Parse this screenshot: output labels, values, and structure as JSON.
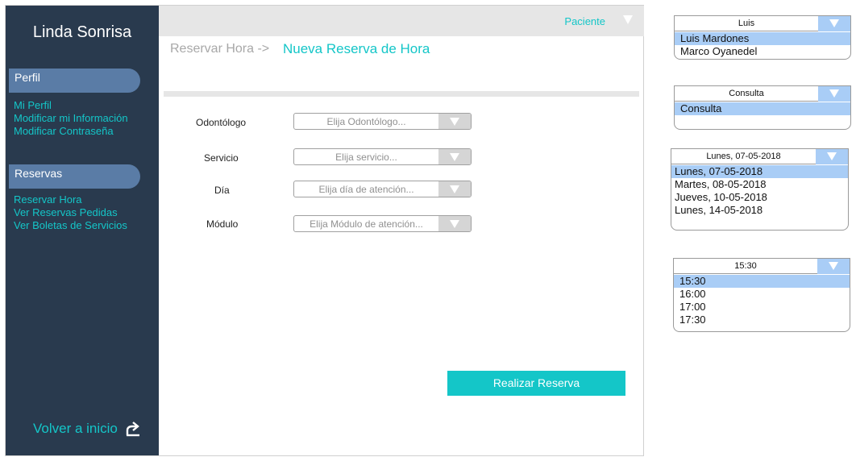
{
  "sidebar": {
    "brand": "Linda Sonrisa",
    "perfil": {
      "title": "Perfil",
      "links": [
        "Mi Perfil",
        "Modificar mi Información",
        "Modificar Contraseña"
      ]
    },
    "reservas": {
      "title": "Reservas",
      "links": [
        "Reservar Hora",
        "Ver Reservas Pedidas",
        "Ver Boletas de Servicios"
      ]
    },
    "back_label": "Volver a inicio",
    "back_icon": "return-arrow-icon"
  },
  "header": {
    "user_label": "Paciente",
    "user_icon": "caret-down-icon"
  },
  "breadcrumb": {
    "parent": "Reservar Hora ->",
    "current": "Nueva Reserva de Hora"
  },
  "form": {
    "fields": [
      {
        "label": "Odontólogo",
        "placeholder": "Elija Odontólogo..."
      },
      {
        "label": "Servicio",
        "placeholder": "Elija servicio..."
      },
      {
        "label": "Día",
        "placeholder": "Elija día de atención..."
      },
      {
        "label": "Módulo",
        "placeholder": "Elija Módulo de atención..."
      }
    ],
    "submit_label": "Realizar Reserva"
  },
  "dropdown_examples": {
    "odontologo": {
      "selected": "Luis",
      "options": [
        "Luis Mardones",
        "Marco Oyanedel"
      ]
    },
    "servicio": {
      "selected": "Consulta",
      "options": [
        "Consulta"
      ]
    },
    "dia": {
      "selected": "Lunes, 07-05-2018",
      "options": [
        "Lunes, 07-05-2018",
        "Martes, 08-05-2018",
        "Jueves, 10-05-2018",
        "Lunes, 14-05-2018"
      ]
    },
    "modulo": {
      "selected": "15:30",
      "options": [
        "15:30",
        "16:00",
        "17:00",
        "17:30"
      ]
    }
  },
  "colors": {
    "sidebar_bg": "#293a4e",
    "accent": "#14c6c8",
    "section_pill": "#5a7ca6",
    "option_highlight": "#a9cdf6"
  }
}
